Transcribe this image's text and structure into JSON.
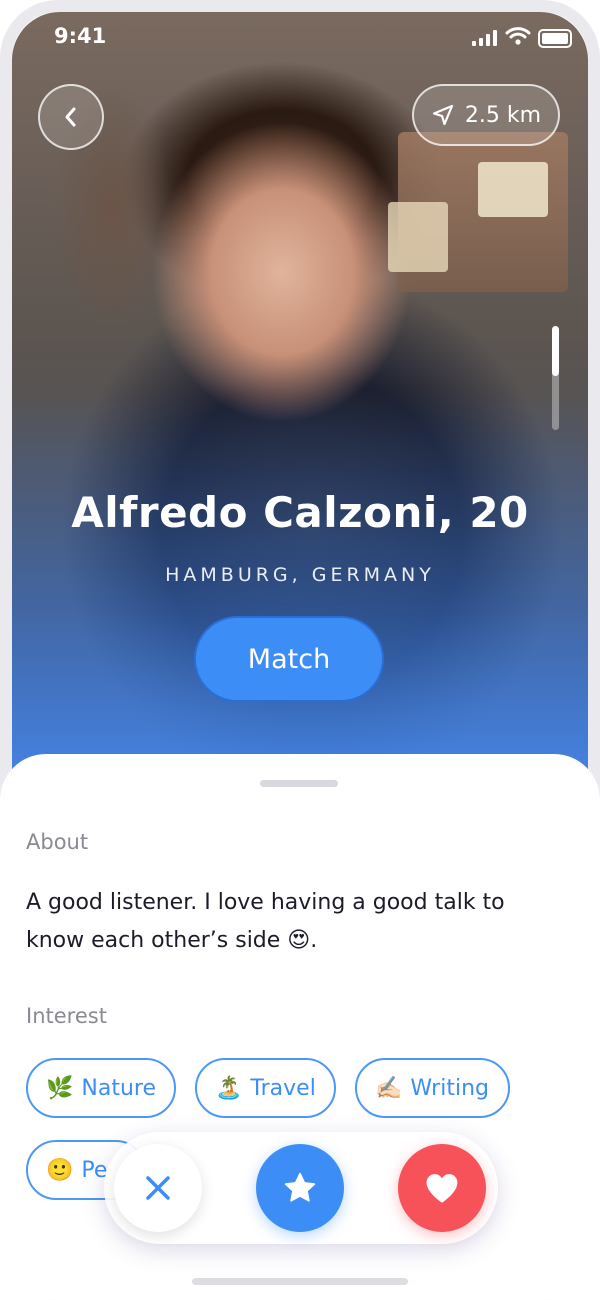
{
  "status_bar": {
    "time": "9:41"
  },
  "profile": {
    "name_age": "Alfredo Calzoni, 20",
    "location": "HAMBURG, GERMANY",
    "distance": "2.5 km",
    "match_label": "Match"
  },
  "about": {
    "label": "About",
    "text": "A good listener. I love having a good talk to know each other’s side 😍."
  },
  "interest": {
    "label": "Interest",
    "chips": [
      {
        "emoji": "🌿",
        "label": "Nature"
      },
      {
        "emoji": "🏝️",
        "label": "Travel"
      },
      {
        "emoji": "✍🏻",
        "label": "Writing"
      },
      {
        "emoji": "🙂",
        "label": "Pe"
      }
    ]
  },
  "colors": {
    "accent": "#3c8ef6",
    "like": "#f7525a"
  },
  "icons": [
    "back-chevron-icon",
    "location-arrow-icon",
    "close-icon",
    "star-icon",
    "heart-icon"
  ]
}
